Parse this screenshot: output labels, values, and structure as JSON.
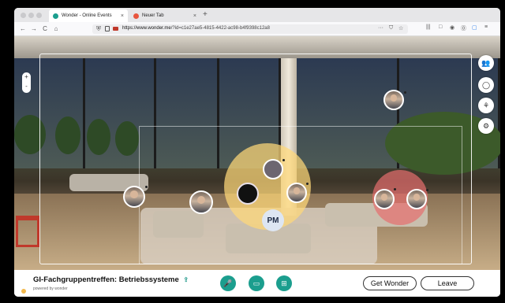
{
  "browser": {
    "tabs": [
      {
        "label": "Wonder - Online Events",
        "close": "×",
        "favicon_color": "#1b9e8e"
      },
      {
        "label": "Neuer Tab",
        "close": "×",
        "favicon_color": "#e8553e"
      }
    ],
    "new_tab": "+",
    "nav": {
      "back": "←",
      "forward": "→",
      "reload": "C",
      "home": "⌂"
    },
    "url_host": "https://www.wonder.me",
    "url_path": "/?id=c1e27ae5-4815-4422-ac98-b4f9398c12a8",
    "url_actions": {
      "more": "···",
      "pocket": "⛉",
      "star": "☆"
    },
    "toolbar_right": [
      "|||",
      "□",
      "◉",
      "⓪",
      "▢",
      "≡"
    ]
  },
  "scene": {
    "zoom_in": "+",
    "zoom_out": "-",
    "side_buttons": [
      "👥",
      "◯",
      "⚘",
      "⚙"
    ],
    "pm_initials": "PM"
  },
  "bottom": {
    "event_title": "GI-Fachgruppentreffen: Betriebssysteme",
    "share_icon": "⇪",
    "powered_by": "powered by wonder",
    "controls": [
      "🎤",
      "▭",
      "⊞"
    ],
    "get_wonder": "Get Wonder",
    "leave": "Leave"
  },
  "colors": {
    "accent": "#1b9e8e",
    "yellow_circle": "#ffd878",
    "red_circle": "#e66e6e"
  }
}
